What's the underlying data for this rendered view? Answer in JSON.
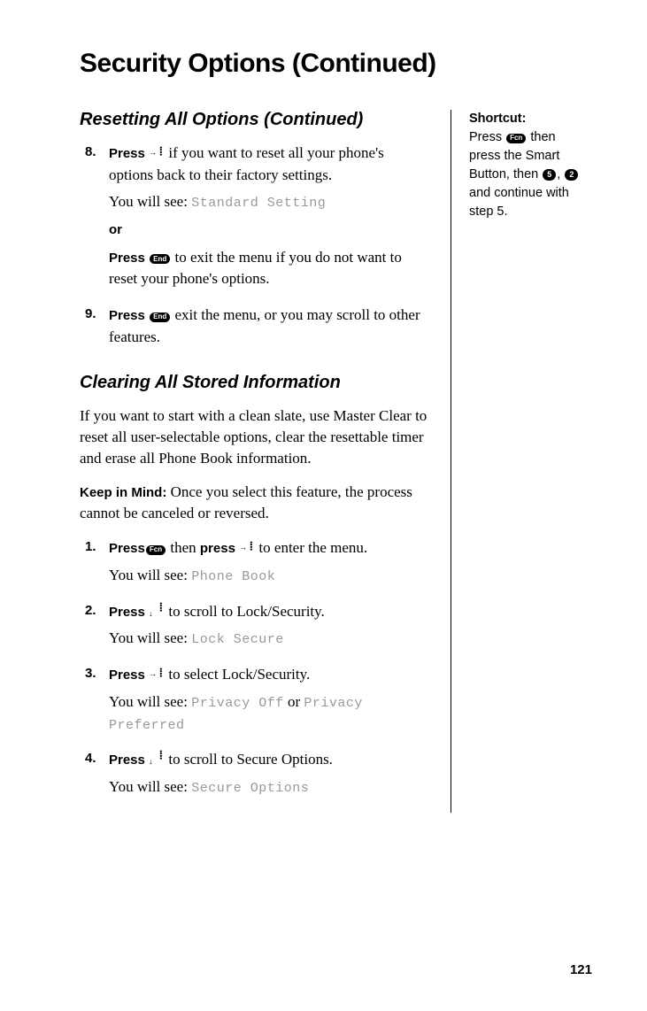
{
  "title": "Security Options (Continued)",
  "page_number": "121",
  "section1": {
    "heading": "Resetting All Options (Continued)",
    "steps": [
      {
        "num": "8.",
        "press": "Press",
        "text_a": " if you want to reset all your phone's options back to their factory settings.",
        "youwillsee": "You will see: ",
        "display": "Standard Setting",
        "or": "or",
        "press2": "Press",
        "text_b": " to exit the menu if you do not want to reset your phone's options."
      },
      {
        "num": "9.",
        "press": "Press",
        "text_a": " exit the menu, or you may scroll to other features."
      }
    ]
  },
  "section2": {
    "heading": "Clearing All Stored Information",
    "intro": "If you want to start with a clean slate, use Master Clear to reset all user-selectable options, clear the resettable timer and erase all Phone Book information.",
    "keep_label": "Keep in Mind:",
    "keep_text": " Once you select this feature, the process cannot be canceled or reversed.",
    "steps": [
      {
        "num": "1.",
        "press": "Press",
        "mid": " then ",
        "press2": "press",
        "text_a": " to enter the menu.",
        "youwillsee": "You will see: ",
        "display": "Phone Book"
      },
      {
        "num": "2.",
        "press": "Press",
        "text_a": " to scroll to Lock/Security.",
        "youwillsee": "You will see: ",
        "display": "Lock Secure"
      },
      {
        "num": "3.",
        "press": "Press",
        "text_a": " to select Lock/Security.",
        "youwillsee": "You will see: ",
        "display": "Privacy Off",
        "ortxt": " or ",
        "display2": "Privacy Preferred"
      },
      {
        "num": "4.",
        "press": "Press",
        "text_a": " to scroll to Secure Options.",
        "youwillsee": "You will see: ",
        "display": "Secure Options"
      }
    ]
  },
  "sidebar": {
    "label": "Shortcut:",
    "l1": "Press ",
    "l2": " then press the Smart Button, then ",
    "comma": ", ",
    "l3": " and continue with step 5."
  },
  "icons": {
    "fcn": "Fcn",
    "end": "End",
    "five": "5",
    "two": "2"
  }
}
